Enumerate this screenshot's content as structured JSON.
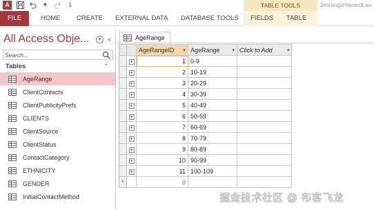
{
  "titlebar": {
    "app_icon_letter": "A",
    "context_group": "TABLE TOOLS",
    "user": "JenningsHavardLav"
  },
  "ribbon": {
    "tabs": [
      "FILE",
      "HOME",
      "CREATE",
      "EXTERNAL DATA",
      "DATABASE TOOLS",
      "FIELDS",
      "TABLE"
    ]
  },
  "nav": {
    "header": "All Access Obje...",
    "search_placeholder": "Search...",
    "group": "Tables",
    "items": [
      "AgeRange",
      "ClientContacts",
      "ClientPublicityPrefs",
      "CLIENTS",
      "ClientSource",
      "ClientStatus",
      "ContactCategory",
      "ETHNICITY",
      "GENDER",
      "InitialContactMethod"
    ],
    "selected": "AgeRange"
  },
  "document": {
    "tab_label": "AgeRange",
    "columns": [
      "AgeRangeID",
      "AgeRange",
      "Click to Add"
    ],
    "rows": [
      [
        "1",
        "0-9"
      ],
      [
        "2",
        "10-19"
      ],
      [
        "3",
        "20-29"
      ],
      [
        "4",
        "30-39"
      ],
      [
        "5",
        "40-49"
      ],
      [
        "6",
        "50-59"
      ],
      [
        "7",
        "60-69"
      ],
      [
        "8",
        "70-79"
      ],
      [
        "9",
        "80-89"
      ],
      [
        "10",
        "90-99"
      ],
      [
        "11",
        "100-109"
      ]
    ],
    "new_row_value": "0"
  },
  "watermark": "掘金技术社区 @ 布客飞龙",
  "colors": {
    "access_red": "#a4373a",
    "selected_nav": "#f6c7c9",
    "context_tab": "#f9e7c0",
    "id_header": "#f7d7a8"
  }
}
